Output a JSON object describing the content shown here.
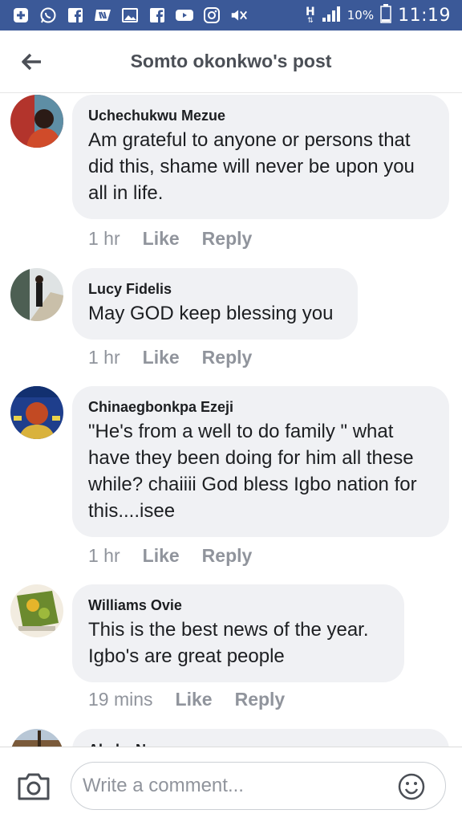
{
  "status_bar": {
    "network_type": "H",
    "battery": "10%",
    "time": "11:19",
    "icons": [
      "add-icon",
      "whatsapp-icon",
      "facebook-icon",
      "news-icon",
      "gallery-icon",
      "facebook-icon",
      "youtube-icon",
      "instagram-icon",
      "mute-icon",
      "network-h-icon",
      "signal-icon",
      "battery-icon"
    ]
  },
  "header": {
    "title": "Somto okonkwo's post"
  },
  "comments": [
    {
      "author": "Uchechukwu Mezue",
      "text": "Am grateful to anyone or persons that did this, shame will never be upon you all in life.",
      "time": "1 hr",
      "like": "Like",
      "reply": "Reply"
    },
    {
      "author": "Lucy Fidelis",
      "text": "May GOD keep blessing you",
      "time": "1 hr",
      "like": "Like",
      "reply": "Reply"
    },
    {
      "author": "Chinaegbonkpa Ezeji",
      "text": "\"He's from a well to do family \" what have they been doing for him all these while? chaiiii God bless Igbo nation for this....isee",
      "time": "1 hr",
      "like": "Like",
      "reply": "Reply"
    },
    {
      "author": "Williams Ovie",
      "text": "This is the best news of the year. Igbo's are great people",
      "time": "19 mins",
      "like": "Like",
      "reply": "Reply"
    },
    {
      "author": "Ahaka N",
      "text": "",
      "time": "",
      "like": "",
      "reply": ""
    }
  ],
  "composer": {
    "placeholder": "Write a comment..."
  },
  "colors": {
    "brand": "#3b5998",
    "bubble": "#f0f1f4",
    "meta": "#90949c"
  }
}
